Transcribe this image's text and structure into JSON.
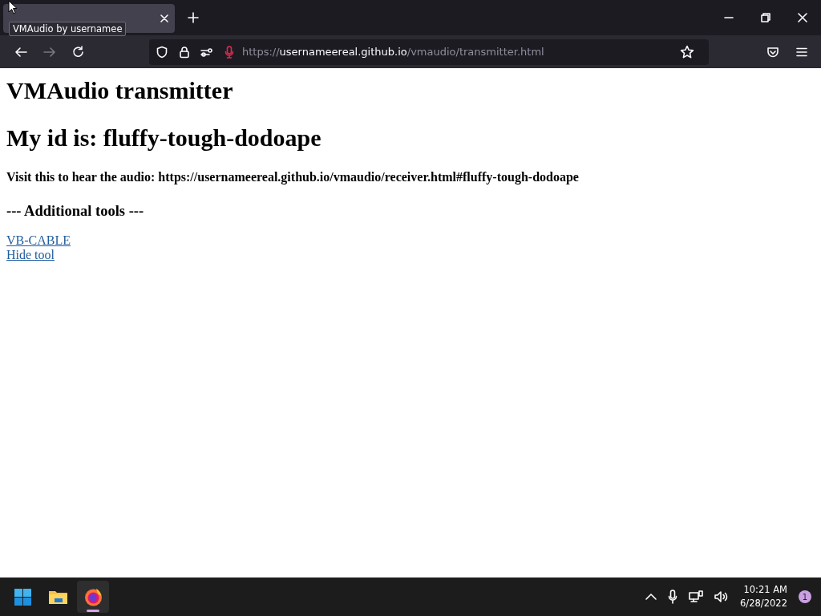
{
  "browser": {
    "tabs": [
      {
        "selected": true,
        "tooltip": "VMAudio by usernamee"
      }
    ],
    "nav_buttons": [
      {
        "kind": "back",
        "disabled": false
      },
      {
        "kind": "forward",
        "disabled": true
      },
      {
        "kind": "reload",
        "disabled": false
      }
    ],
    "address_bar": {
      "scheme": "https://",
      "host": "usernameereal.github.io",
      "path": "/vmaudio/transmitter.html",
      "microphone_in_use": true
    }
  },
  "page": {
    "items": [
      {
        "kind": "title",
        "text": "VMAudio transmitter"
      },
      {
        "kind": "title",
        "text": "My id is: fluffy-tough-dodoape"
      },
      {
        "kind": "note",
        "text": "Visit this to hear the audio: https://usernameereal.github.io/vmaudio/receiver.html#fluffy-tough-dodoape"
      },
      {
        "kind": "subtitle",
        "text": "--- Additional tools ---"
      },
      {
        "kind": "link",
        "text": "VB-CABLE"
      },
      {
        "kind": "link",
        "text": "Hide tool"
      }
    ]
  },
  "taskbar": {
    "apps": [
      {
        "kind": "start",
        "selected": false
      },
      {
        "kind": "files",
        "selected": false
      },
      {
        "kind": "firefox",
        "selected": true
      }
    ],
    "time": "10:21 AM",
    "date": "6/28/2022",
    "notifications": "1"
  }
}
